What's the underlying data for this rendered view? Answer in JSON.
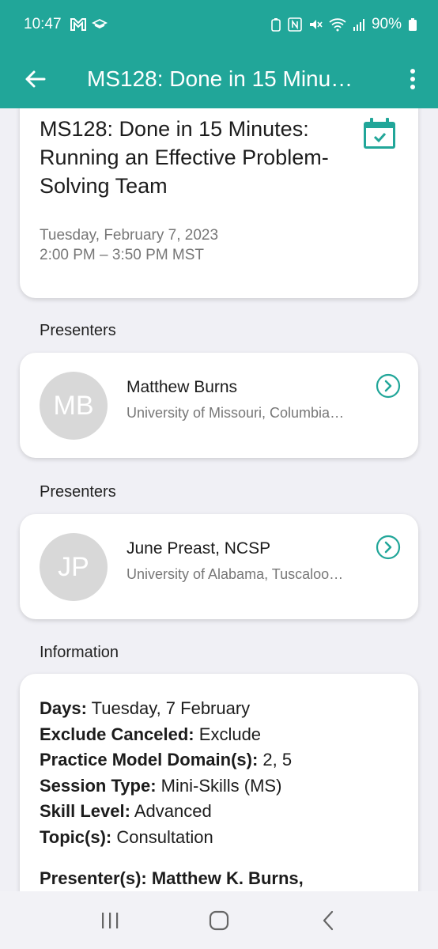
{
  "status_bar": {
    "time": "10:47",
    "battery": "90%",
    "left_icons": [
      "gmail-icon",
      "cast-icon"
    ],
    "right_icons": [
      "battery-saver-icon",
      "nfc-icon",
      "mute-icon",
      "wifi-icon",
      "signal-icon",
      "battery-icon"
    ]
  },
  "app_bar": {
    "title": "MS128: Done in 15 Minu…"
  },
  "session": {
    "title": "MS128: Done in 15 Minutes: Running an Effective Problem-Solving Team",
    "date": "Tuesday, February 7, 2023",
    "time": "2:00 PM – 3:50 PM MST"
  },
  "presenter_sections": [
    {
      "label": "Presenters",
      "initials": "MB",
      "name": "Matthew Burns",
      "org": "University of Missouri, Columbia…"
    },
    {
      "label": "Presenters",
      "initials": "JP",
      "name": "June Preast, NCSP",
      "org": "University of Alabama, Tuscaloo…"
    }
  ],
  "information": {
    "label": "Information",
    "rows": [
      {
        "key": "Days:",
        "value": "Tuesday, 7 February"
      },
      {
        "key": "Exclude Canceled:",
        "value": "Exclude"
      },
      {
        "key": "Practice Model Domain(s):",
        "value": "2, 5"
      },
      {
        "key": "Session Type:",
        "value": "Mini-Skills (MS)"
      },
      {
        "key": "Skill Level:",
        "value": "Advanced"
      },
      {
        "key": "Topic(s):",
        "value": "Consultation"
      }
    ],
    "presenter_line": "Presenter(s): Matthew K. Burns,"
  },
  "colors": {
    "accent": "#21a699",
    "background": "#f0f0f5"
  }
}
